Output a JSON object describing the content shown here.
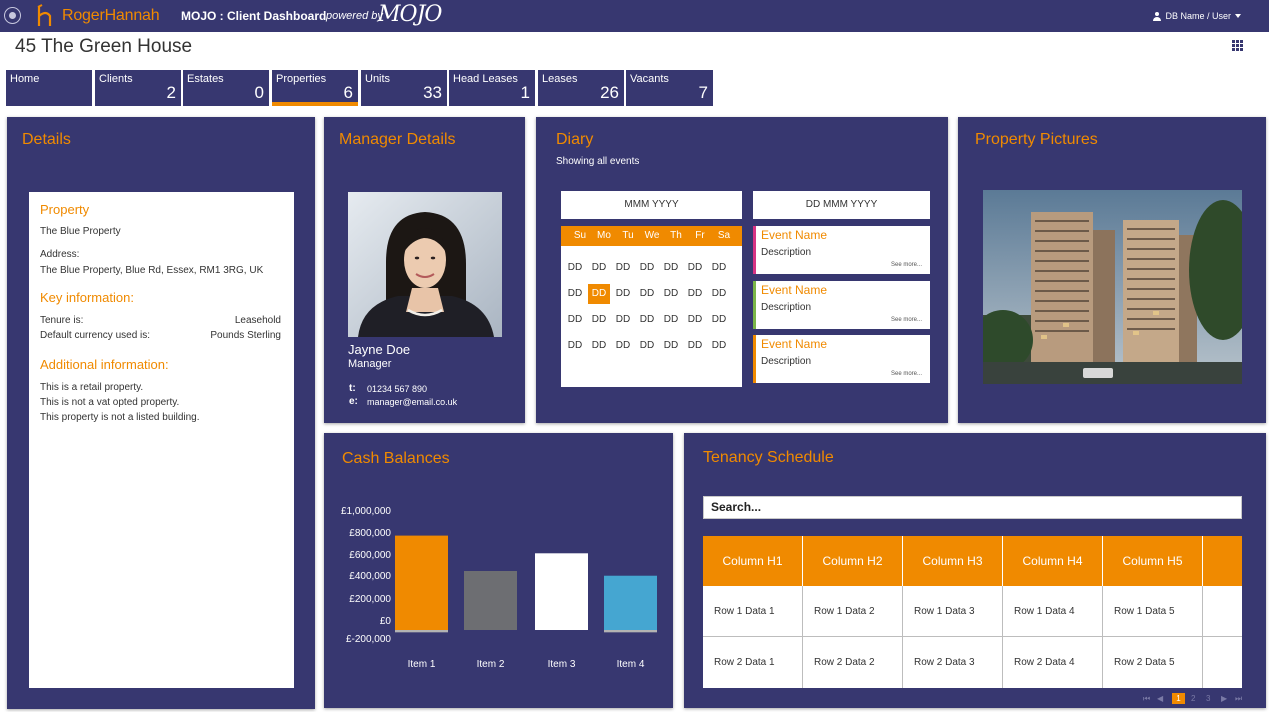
{
  "header": {
    "logo_text": "RogerHannah",
    "app_title": "MOJO : Client Dashboard",
    "powered_by": "powered by",
    "mojo_logo": "MOJO",
    "user": "DB Name / User"
  },
  "page_title": "45 The Green House",
  "nav": [
    {
      "label": "Home",
      "count": ""
    },
    {
      "label": "Clients",
      "count": "2"
    },
    {
      "label": "Estates",
      "count": "0"
    },
    {
      "label": "Properties",
      "count": "6"
    },
    {
      "label": "Units",
      "count": "33"
    },
    {
      "label": "Head Leases",
      "count": "1"
    },
    {
      "label": "Leases",
      "count": "26"
    },
    {
      "label": "Vacants",
      "count": "7"
    }
  ],
  "details": {
    "title": "Details",
    "property_heading": "Property",
    "property_name": "The Blue Property",
    "address_label": "Address:",
    "address": "The Blue Property, Blue Rd, Essex, RM1 3RG, UK",
    "key_heading": "Key information:",
    "tenure_label": "Tenure is:",
    "tenure_value": "Leasehold",
    "currency_label": "Default currency used is:",
    "currency_value": "Pounds Sterling",
    "additional_heading": "Additional information:",
    "additional_lines": [
      "This is a retail property.",
      "This is not a vat opted property.",
      "This property is not a listed building."
    ]
  },
  "manager": {
    "title": "Manager Details",
    "name": "Jayne Doe",
    "role": "Manager",
    "tel_label": "t:",
    "tel": "01234 567 890",
    "email_label": "e:",
    "email": "manager@email.co.uk"
  },
  "diary": {
    "title": "Diary",
    "subtitle": "Showing all events",
    "month_label": "MMM YYYY",
    "days": [
      "Su",
      "Mo",
      "Tu",
      "We",
      "Th",
      "Fr",
      "Sa"
    ],
    "day_placeholder": "DD",
    "event_date": "DD MMM YYYY",
    "events": [
      {
        "name": "Event Name",
        "description": "Description",
        "more": "See more...",
        "color": "#d63384"
      },
      {
        "name": "Event Name",
        "description": "Description",
        "more": "See more...",
        "color": "#7ab648"
      },
      {
        "name": "Event Name",
        "description": "Description",
        "more": "See more...",
        "color": "#f08a00"
      }
    ]
  },
  "pictures": {
    "title": "Property Pictures"
  },
  "cash": {
    "title": "Cash Balances"
  },
  "chart_data": {
    "type": "bar",
    "title": "Cash Balances",
    "categories": [
      "Item 1",
      "Item 2",
      "Item 3",
      "Item 4"
    ],
    "series": [
      {
        "values": [
          800000,
          500000,
          650000,
          460000
        ],
        "colors": [
          "#f08a00",
          "#6d6e72",
          "#ffffff",
          "#45a6d1"
        ]
      },
      {
        "values": [
          -60000,
          0,
          0,
          -60000
        ],
        "color": "#b3b3b3"
      }
    ],
    "y_ticks": [
      "£1,000,000",
      "£800,000",
      "£600,000",
      "£400,000",
      "£200,000",
      "£0",
      "£-200,000"
    ],
    "ylim": [
      -200000,
      1000000
    ],
    "grid": false,
    "legend": "none"
  },
  "tenancy": {
    "title": "Tenancy Schedule",
    "search_placeholder": "Search...",
    "columns": [
      "Column H1",
      "Column H2",
      "Column H3",
      "Column H4",
      "Column H5"
    ],
    "rows": [
      [
        "Row 1 Data 1",
        "Row 1 Data 2",
        "Row 1 Data 3",
        "Row 1 Data 4",
        "Row 1 Data 5"
      ],
      [
        "Row 2 Data 1",
        "Row 2 Data 2",
        "Row 2 Data 3",
        "Row 2 Data 4",
        "Row 2 Data 5"
      ]
    ],
    "pages": [
      "1",
      "2",
      "3"
    ]
  },
  "colors": {
    "brand": "#373770",
    "accent": "#f08a00"
  }
}
